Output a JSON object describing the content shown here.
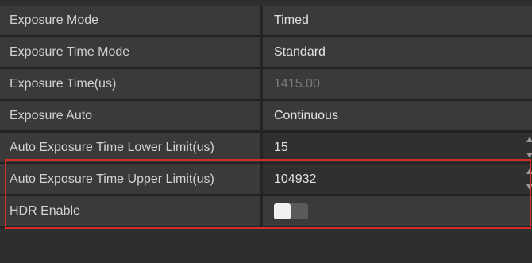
{
  "properties": [
    {
      "label": "Exposure Mode",
      "value": "Timed",
      "kind": "dropdown"
    },
    {
      "label": "Exposure Time Mode",
      "value": "Standard",
      "kind": "dropdown"
    },
    {
      "label": "Exposure Time(us)",
      "value": "1415.00",
      "kind": "disabled"
    },
    {
      "label": "Exposure Auto",
      "value": "Continuous",
      "kind": "dropdown"
    },
    {
      "label": "Auto Exposure Time Lower Limit(us)",
      "value": "15",
      "kind": "spinbox"
    },
    {
      "label": "Auto Exposure Time Upper Limit(us)",
      "value": "104932",
      "kind": "spinbox"
    },
    {
      "label": "HDR Enable",
      "value": "",
      "kind": "toggle",
      "toggle_state": "off"
    }
  ],
  "highlight_color": "#d42b2b"
}
